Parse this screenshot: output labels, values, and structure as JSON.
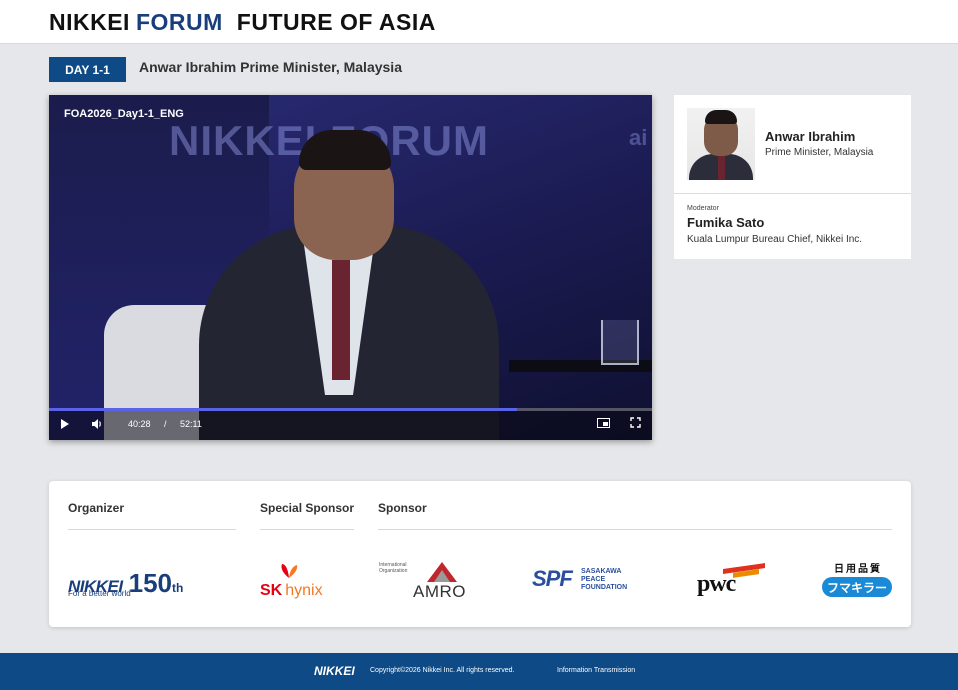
{
  "header": {
    "brand_part1": "NIKKEI",
    "brand_part2": "FORUM",
    "brand_part3": "FUTURE OF ASIA"
  },
  "session": {
    "day_label": "DAY 1-1",
    "title": "Anwar Ibrahim Prime Minister, Malaysia"
  },
  "video": {
    "file_title": "FOA2026_Day1-1_ENG",
    "background_text": "NIKKEI FORUM",
    "background_text2": "ai",
    "current_time": "40:28",
    "separator": "/",
    "total_time": "52:11",
    "progress": 0.776,
    "accent_color": "#5a63e8"
  },
  "speaker": {
    "name": "Anwar Ibrahim",
    "role": "Prime Minister, Malaysia"
  },
  "moderator": {
    "label": "Moderator",
    "name": "Fumika Sato",
    "role": "Kuala Lumpur Bureau Chief, Nikkei Inc."
  },
  "sponsors": {
    "organizer_heading": "Organizer",
    "special_heading": "Special Sponsor",
    "sponsor_heading": "Sponsor",
    "nikkei150": {
      "name": "NIKKEI",
      "number": "150",
      "suffix": "th",
      "tagline": "For a better world"
    },
    "sk": {
      "name": "SK",
      "suffix": "hynix"
    },
    "amro": {
      "small": "International Organization",
      "name": "AMRO"
    },
    "spf": {
      "mark": "SPF",
      "line1": "SASAKAWA",
      "line2": "PEACE",
      "line3": "FOUNDATION"
    },
    "pwc": {
      "name": "pwc"
    },
    "fumakilla": {
      "top": "日用品質",
      "name": "フマキラー"
    }
  },
  "footer": {
    "logo": "NIKKEI",
    "copyright": "Copyright©2026 Nikkei Inc. All rights reserved.",
    "link": "Information Transmission"
  },
  "colors": {
    "brand_blue": "#0d4a86",
    "brand_navy": "#1a3e7c",
    "page_bg": "#e6e7ea"
  },
  "icons": [
    "play-icon",
    "volume-icon",
    "picture-in-picture-icon",
    "fullscreen-icon"
  ]
}
